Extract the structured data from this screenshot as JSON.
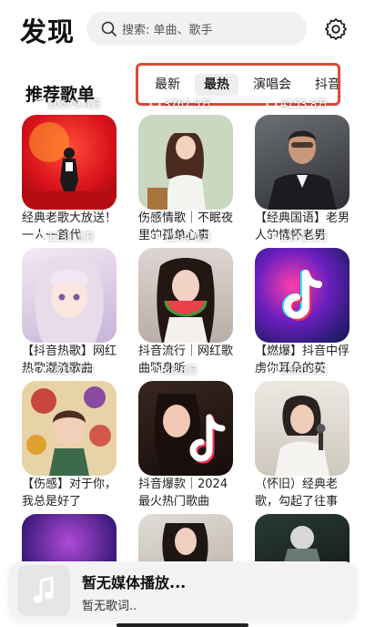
{
  "header": {
    "title": "发现",
    "search_placeholder": "搜索: 单曲、歌手"
  },
  "section": {
    "title": "推荐歌单",
    "tabs": [
      {
        "label": "最新",
        "active": false
      },
      {
        "label": "最热",
        "active": true
      },
      {
        "label": "演唱会",
        "active": false
      },
      {
        "label": "抖音",
        "active": false
      }
    ]
  },
  "playlists": [
    {
      "plays": "10579.4万",
      "title": "经典老歌大放送！一人一首代",
      "cover": "red-stage-singer"
    },
    {
      "plays": "3767.5万",
      "title": "伤感情歌｜不眠夜里的孤单心事",
      "cover": "green-girl-illustration"
    },
    {
      "plays": "4153.8万",
      "title": "【经典国语】老男人的情怀老男",
      "cover": "man-in-suit"
    },
    {
      "plays": "1231.2万",
      "title": "【抖音热歌】网红热歌潮流歌曲",
      "cover": "pink-anime-girl"
    },
    {
      "plays": "1294.6万",
      "title": "抖音流行｜网红歌曲随身听",
      "cover": "girl-with-watermelon"
    },
    {
      "plays": "2571.3万",
      "title": "【燃爆】抖音中俘虏你耳朵的英",
      "cover": "tiktok-neon"
    },
    {
      "plays": "2812.7万",
      "title": "【伤感】对于你，我总是好了",
      "cover": "flowers-portrait"
    },
    {
      "plays": "66.8万",
      "title": "抖音爆款｜2024最火热门歌曲",
      "cover": "tiktok-girl"
    },
    {
      "plays": "2360.5万",
      "title": "（怀旧）经典老歌，勾起了往事",
      "cover": "singer-with-mic"
    }
  ],
  "player": {
    "title": "暂无媒体播放...",
    "subtitle": "暂无歌词.."
  },
  "colors": {
    "highlight_border": "#d94a3a",
    "tab_active_bg": "#eeeef0",
    "search_bg": "#f1f1f3"
  }
}
